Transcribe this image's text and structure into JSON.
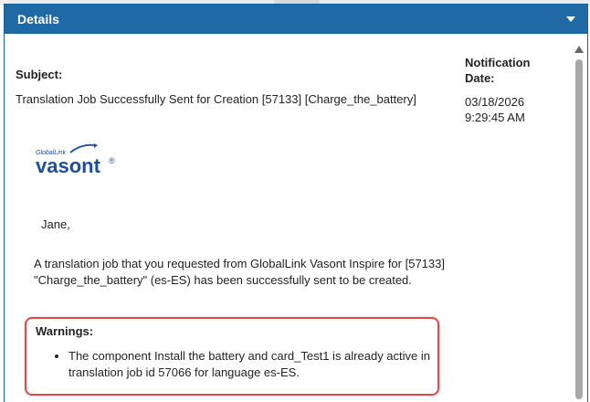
{
  "panel": {
    "title": "Details"
  },
  "notification": {
    "subject_label": "Subject:",
    "subject_text": "Translation Job Successfully Sent for Creation [57133] [Charge_the_battery]",
    "date_label": "Notification Date:",
    "date_value": "03/18/2026 9:29:45 AM"
  },
  "logo": {
    "small_text": "GlobalLink",
    "brand_text": "vasont",
    "registered": "®"
  },
  "body": {
    "greeting": "Jane,",
    "message": "A translation job that you requested from GlobalLink Vasont Inspire for [57133] \"Charge_the_battery\" (es-ES) has been successfully sent to be created."
  },
  "warnings": {
    "title": "Warnings:",
    "items": [
      "The component Install the battery and card_Test1 is already active in translation job id 57066 for language es-ES."
    ]
  },
  "colors": {
    "header": "#1f6aa5",
    "warning_border": "#dd4b4b",
    "logo_blue": "#1c4f9c"
  },
  "icons": {
    "collapse": "chevron-down-icon",
    "scroll_up": "arrow-up-icon"
  }
}
